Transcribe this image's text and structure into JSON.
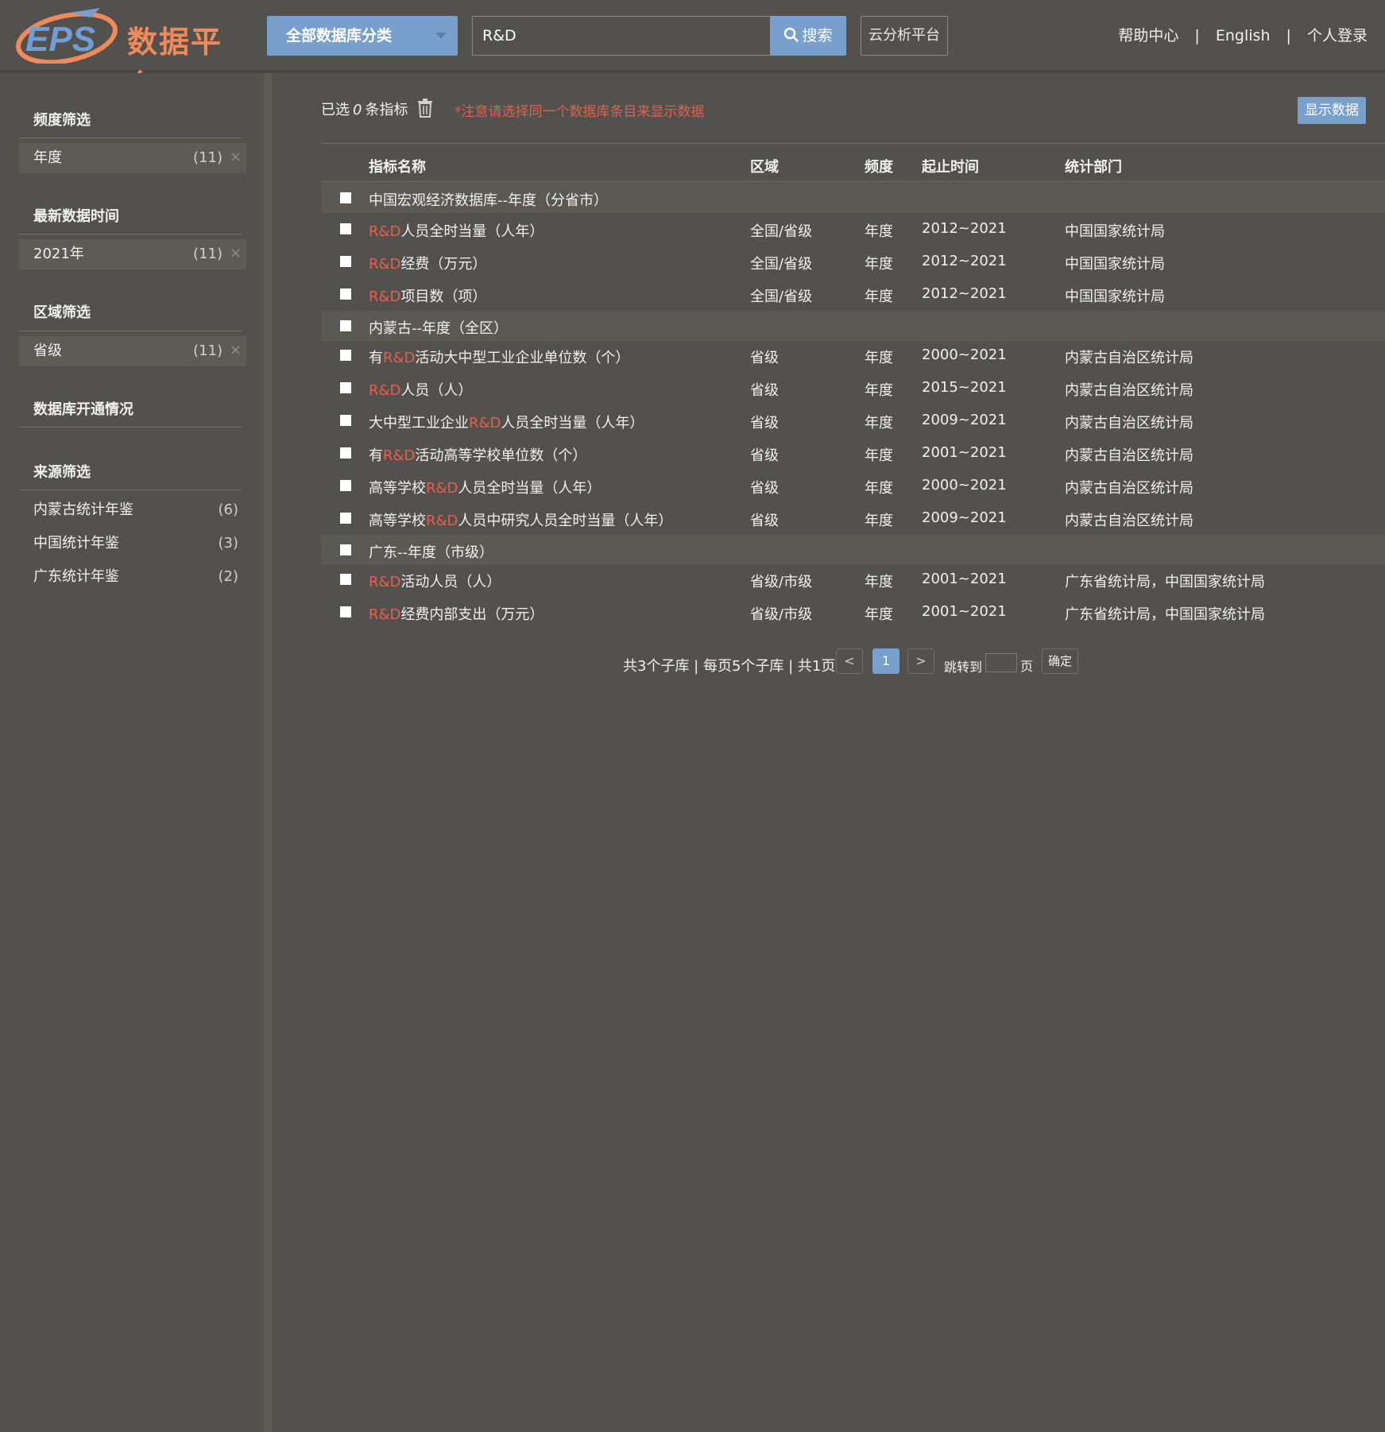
{
  "header": {
    "logo_mark": "EPS",
    "logo_text": "数据平台",
    "category_label": "全部数据库分类",
    "search_value": "R&D",
    "search_button": "搜索",
    "cloud_button": "云分析平台",
    "links": [
      "帮助中心",
      "English",
      "个人登录"
    ],
    "separator": "|"
  },
  "sidebar": {
    "freq_title": "频度筛选",
    "freq_chip": {
      "label": "年度",
      "count": "(11)",
      "remove": "×"
    },
    "latest_title": "最新数据时间",
    "latest_chip": {
      "label": "2021年",
      "count": "(11)",
      "remove": "×"
    },
    "region_title": "区域筛选",
    "region_chip": {
      "label": "省级",
      "count": "(11)",
      "remove": "×"
    },
    "db_title": "数据库开通情况",
    "source_title": "来源筛选",
    "sources": [
      {
        "label": "内蒙古统计年鉴",
        "count": "(6)"
      },
      {
        "label": "中国统计年鉴",
        "count": "(3)"
      },
      {
        "label": "广东统计年鉴",
        "count": "(2)"
      }
    ]
  },
  "main": {
    "selected_prefix": "已选",
    "selected_count": "0",
    "selected_suffix": "条指标",
    "notice": "*注意请选择同一个数据库条目来显示数据",
    "show_button": "显示数据",
    "columns": [
      "指标名称",
      "区域",
      "频度",
      "起止时间",
      "统计部门"
    ],
    "groups": [
      {
        "name": "中国宏观经济数据库--年度（分省市）",
        "rows": [
          {
            "pre": "",
            "hl": "R&D",
            "post": "人员全时当量（人年）",
            "region": "全国/省级",
            "freq": "年度",
            "period": "2012~2021",
            "dept": "中国国家统计局"
          },
          {
            "pre": "",
            "hl": "R&D",
            "post": "经费（万元）",
            "region": "全国/省级",
            "freq": "年度",
            "period": "2012~2021",
            "dept": "中国国家统计局"
          },
          {
            "pre": "",
            "hl": "R&D",
            "post": "项目数（项）",
            "region": "全国/省级",
            "freq": "年度",
            "period": "2012~2021",
            "dept": "中国国家统计局"
          }
        ]
      },
      {
        "name": "内蒙古--年度（全区）",
        "rows": [
          {
            "pre": "有",
            "hl": "R&D",
            "post": "活动大中型工业企业单位数（个）",
            "region": "省级",
            "freq": "年度",
            "period": "2000~2021",
            "dept": "内蒙古自治区统计局"
          },
          {
            "pre": "",
            "hl": "R&D",
            "post": "人员（人）",
            "region": "省级",
            "freq": "年度",
            "period": "2015~2021",
            "dept": "内蒙古自治区统计局"
          },
          {
            "pre": "大中型工业企业",
            "hl": "R&D",
            "post": "人员全时当量（人年）",
            "region": "省级",
            "freq": "年度",
            "period": "2009~2021",
            "dept": "内蒙古自治区统计局"
          },
          {
            "pre": "有",
            "hl": "R&D",
            "post": "活动高等学校单位数（个）",
            "region": "省级",
            "freq": "年度",
            "period": "2001~2021",
            "dept": "内蒙古自治区统计局"
          },
          {
            "pre": "高等学校",
            "hl": "R&D",
            "post": "人员全时当量（人年）",
            "region": "省级",
            "freq": "年度",
            "period": "2000~2021",
            "dept": "内蒙古自治区统计局"
          },
          {
            "pre": "高等学校",
            "hl": "R&D",
            "post": "人员中研究人员全时当量（人年）",
            "region": "省级",
            "freq": "年度",
            "period": "2009~2021",
            "dept": "内蒙古自治区统计局"
          }
        ]
      },
      {
        "name": "广东--年度（市级）",
        "rows": [
          {
            "pre": "",
            "hl": "R&D",
            "post": "活动人员（人）",
            "region": "省级/市级",
            "freq": "年度",
            "period": "2001~2021",
            "dept": "广东省统计局，中国国家统计局"
          },
          {
            "pre": "",
            "hl": "R&D",
            "post": "经费内部支出（万元）",
            "region": "省级/市级",
            "freq": "年度",
            "period": "2001~2021",
            "dept": "广东省统计局，中国国家统计局"
          }
        ]
      }
    ],
    "pagination": {
      "summary": "共3个子库 | 每页5个子库 | 共1页",
      "prev": "<",
      "current": "1",
      "next": ">",
      "jump_label": "跳转到",
      "page_label": "页",
      "ok": "确定"
    }
  },
  "colors": {
    "background": "#52514d",
    "accent": "#79a0cc",
    "highlight": "#e85d4e",
    "logo": "#f08a5a"
  }
}
